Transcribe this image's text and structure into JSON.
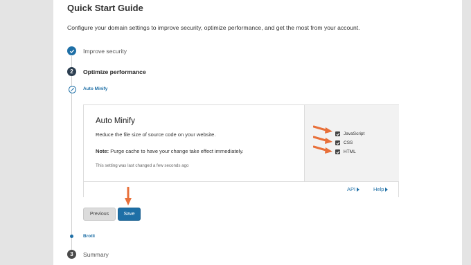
{
  "header": {
    "title": "Quick Start Guide",
    "subtitle": "Configure your domain settings to improve security, optimize performance, and get the most from your account."
  },
  "steps": [
    {
      "number": "✓",
      "label": "Improve security",
      "state": "done"
    },
    {
      "number": "2",
      "label": "Optimize performance",
      "state": "active"
    },
    {
      "number": "3",
      "label": "Summary",
      "state": "pending"
    }
  ],
  "substeps": {
    "auto_minify": "Auto Minify",
    "brotli": "Brotli"
  },
  "card": {
    "title": "Auto Minify",
    "description": "Reduce the file size of source code on your website.",
    "note_label": "Note:",
    "note_text": " Purge cache to have your change take effect immediately.",
    "last_changed": "This setting was last changed a few seconds ago",
    "options": [
      {
        "label": "JavaScript",
        "checked": true
      },
      {
        "label": "CSS",
        "checked": true
      },
      {
        "label": "HTML",
        "checked": true
      }
    ],
    "footer": {
      "api": "API",
      "help": "Help"
    }
  },
  "buttons": {
    "previous": "Previous",
    "save": "Save"
  },
  "colors": {
    "accent": "#1e6fa6",
    "annotation_arrow": "#e8703a"
  },
  "icons": {
    "done": "check-icon",
    "substep": "pencil-icon",
    "link": "caret-right-icon"
  }
}
